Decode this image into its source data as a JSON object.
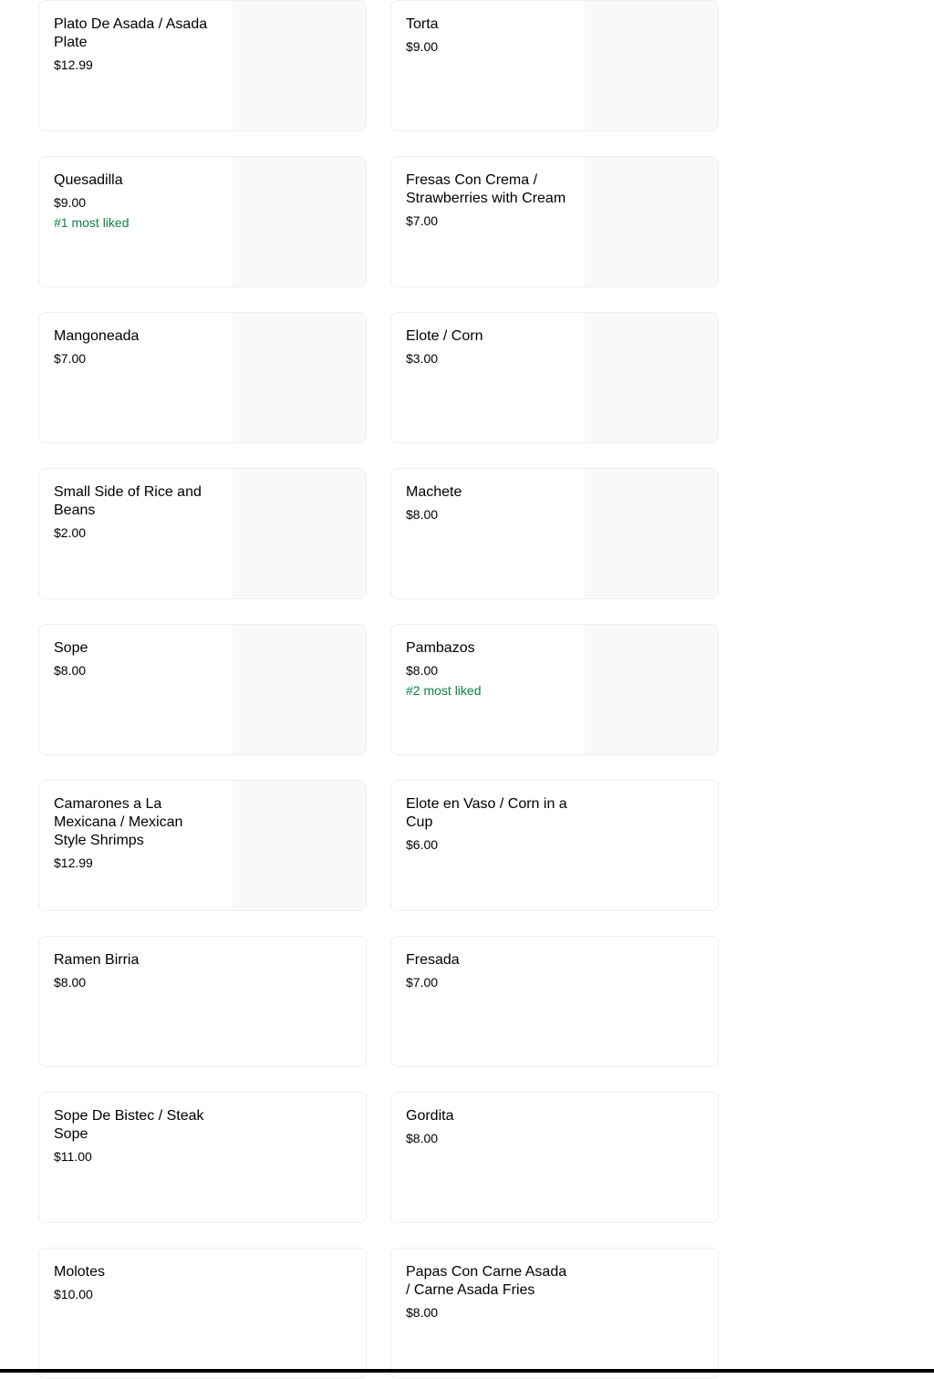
{
  "menu": {
    "items": [
      {
        "name": "Plato De Asada / Asada Plate",
        "price": "$12.99",
        "badge": "",
        "has_photo": true
      },
      {
        "name": "Torta",
        "price": "$9.00",
        "badge": "",
        "has_photo": true
      },
      {
        "name": "Quesadilla",
        "price": "$9.00",
        "badge": "#1 most liked",
        "has_photo": true
      },
      {
        "name": "Fresas Con Crema / Strawberries with Cream",
        "price": "$7.00",
        "badge": "",
        "has_photo": true
      },
      {
        "name": "Mangoneada",
        "price": "$7.00",
        "badge": "",
        "has_photo": true
      },
      {
        "name": "Elote / Corn",
        "price": "$3.00",
        "badge": "",
        "has_photo": true
      },
      {
        "name": "Small Side of Rice and Beans",
        "price": "$2.00",
        "badge": "",
        "has_photo": true
      },
      {
        "name": "Machete",
        "price": "$8.00",
        "badge": "",
        "has_photo": true
      },
      {
        "name": "Sope",
        "price": "$8.00",
        "badge": "",
        "has_photo": true
      },
      {
        "name": "Pambazos",
        "price": "$8.00",
        "badge": "#2 most liked",
        "has_photo": true
      },
      {
        "name": "Camarones a La Mexicana / Mexican Style Shrimps",
        "price": "$12.99",
        "badge": "",
        "has_photo": true
      },
      {
        "name": "Elote en Vaso / Corn in a Cup",
        "price": "$6.00",
        "badge": "",
        "has_photo": false
      },
      {
        "name": "Ramen Birria",
        "price": "$8.00",
        "badge": "",
        "has_photo": false
      },
      {
        "name": "Fresada",
        "price": "$7.00",
        "badge": "",
        "has_photo": false
      },
      {
        "name": "Sope De Bistec / Steak Sope",
        "price": "$11.00",
        "badge": "",
        "has_photo": false
      },
      {
        "name": "Gordita",
        "price": "$8.00",
        "badge": "",
        "has_photo": false
      },
      {
        "name": "Molotes",
        "price": "$10.00",
        "badge": "",
        "has_photo": false
      },
      {
        "name": "Papas Con Carne Asada / Carne Asada Fries",
        "price": "$8.00",
        "badge": "",
        "has_photo": false
      }
    ]
  },
  "colors": {
    "badge": "#0e8345",
    "photo_placeholder": "#f9f9f9",
    "card_border": "#eeeeee"
  }
}
